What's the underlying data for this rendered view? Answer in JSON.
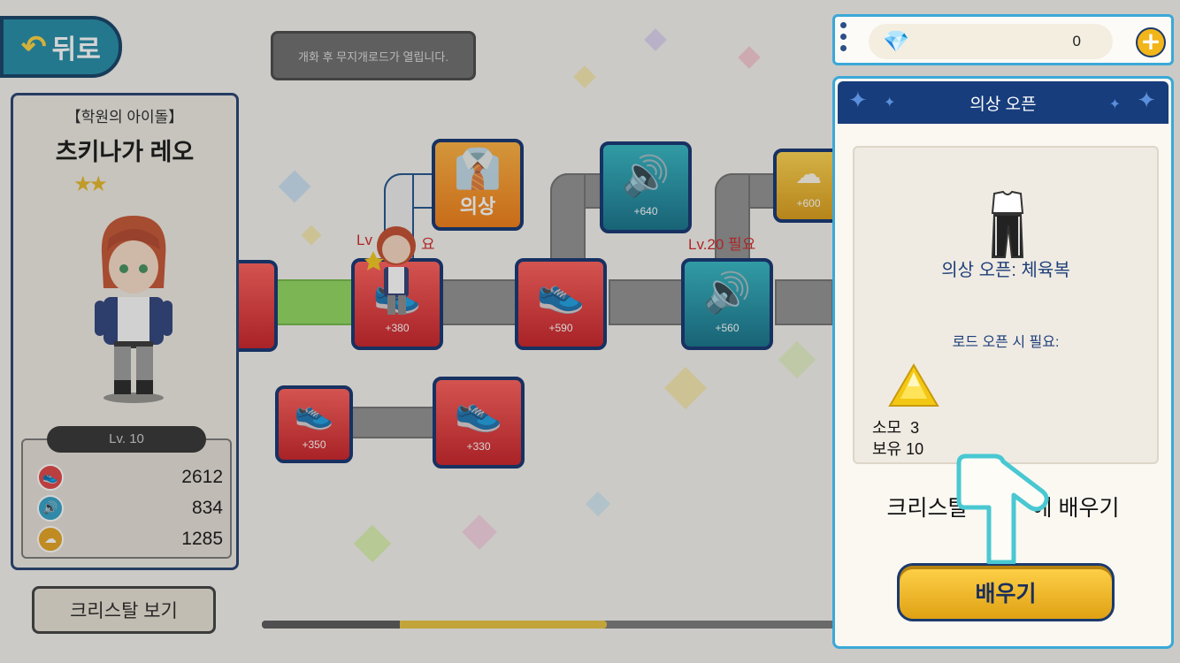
{
  "header": {
    "back_label": "뒤로"
  },
  "map": {
    "tooltip": "개화 후 무지개로드가 열립니다.",
    "nodes": [
      {
        "value": "+640"
      },
      {
        "value": "+600"
      },
      {
        "value": "+590"
      },
      {
        "value": "+560"
      },
      {
        "value": "+350"
      },
      {
        "value": "+330"
      },
      {
        "value": "+380"
      }
    ],
    "costume_node_label": "의상",
    "level_requirements": [
      "Lv.20 필요",
      "Lv"
    ],
    "level_requirement_tail": "요"
  },
  "character": {
    "subtitle": "【학원의 아이돌】",
    "name": "츠키나가 레오",
    "stars": 2,
    "level_text": "Lv.  10",
    "stats": [
      {
        "icon": "shoe-icon",
        "color": "#e04040",
        "value": "2612"
      },
      {
        "icon": "sound-icon",
        "color": "#2e9fc7",
        "value": "834"
      },
      {
        "icon": "cloud-icon",
        "color": "#e6a21c",
        "value": "1285"
      }
    ],
    "crystal_button": "크리스탈 보기",
    "path_progress": 0.6
  },
  "currency": {
    "amount": "0"
  },
  "panel": {
    "title": "의상 오픈",
    "item_title": "의상 오픈: 체육복",
    "requirement_label": "로드 오픈 시 필요:",
    "consume_label": "소모",
    "consume_value": "3",
    "owned_label": "보유",
    "owned_value": "10",
    "learn_text_left": "크리스탈",
    "learn_text_right": "에 배우기",
    "learn_button": "배우기"
  }
}
